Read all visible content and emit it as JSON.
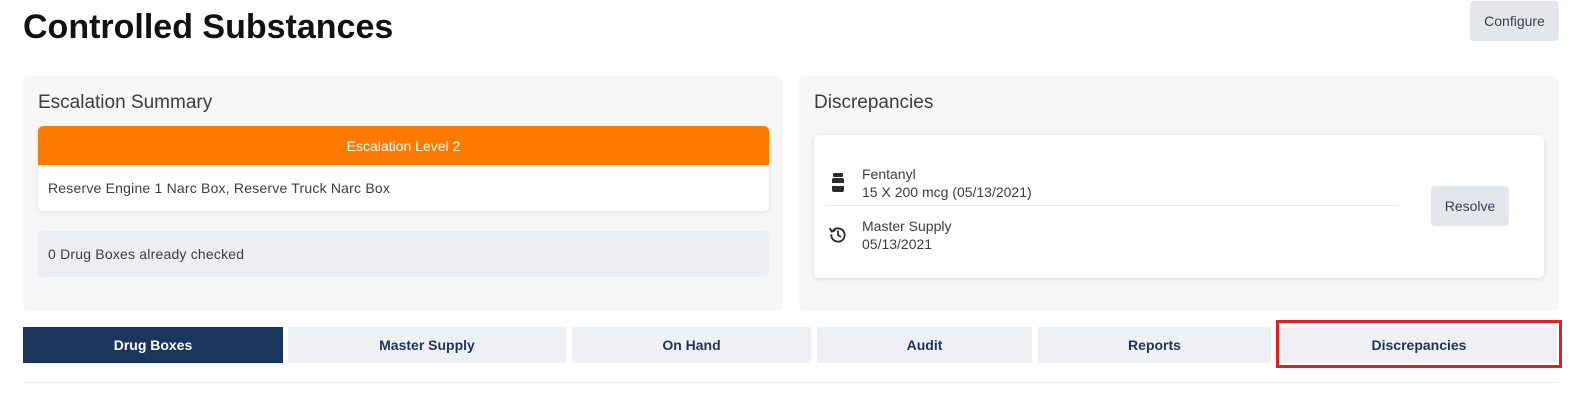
{
  "header": {
    "title": "Controlled Substances",
    "configure_label": "Configure"
  },
  "escalation_summary": {
    "title": "Escalation Summary",
    "level_label": "Escalation Level 2",
    "level_color": "#ff7a00",
    "boxes_text": "Reserve Engine 1 Narc Box, Reserve Truck Narc Box",
    "checked_text": "0 Drug Boxes already checked"
  },
  "discrepancies_panel": {
    "title": "Discrepancies",
    "item": {
      "drug_name": "Fentanyl",
      "drug_detail": "15 X 200 mcg (05/13/2021)",
      "drug_icon": "medicine-bottle-icon",
      "source_name": "Master Supply",
      "source_date": "05/13/2021",
      "source_icon": "history-icon"
    },
    "resolve_label": "Resolve"
  },
  "tabs": [
    {
      "label": "Drug Boxes",
      "active": true
    },
    {
      "label": "Master Supply",
      "active": false
    },
    {
      "label": "On Hand",
      "active": false
    },
    {
      "label": "Audit",
      "active": false
    },
    {
      "label": "Reports",
      "active": false
    },
    {
      "label": "Discrepancies",
      "active": false,
      "highlighted": true
    }
  ],
  "colors": {
    "accent_nav": "#1b365d",
    "highlight_border": "#e02020"
  }
}
